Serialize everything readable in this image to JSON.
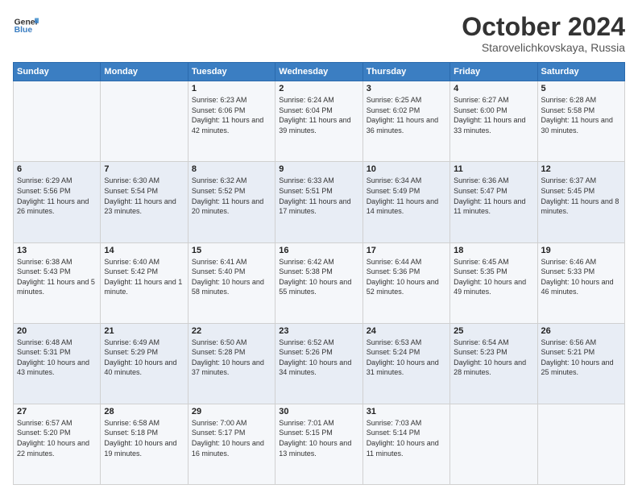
{
  "header": {
    "logo_line1": "General",
    "logo_line2": "Blue",
    "month": "October 2024",
    "location": "Starovelichkovskaya, Russia"
  },
  "weekdays": [
    "Sunday",
    "Monday",
    "Tuesday",
    "Wednesday",
    "Thursday",
    "Friday",
    "Saturday"
  ],
  "weeks": [
    [
      {
        "day": "",
        "text": ""
      },
      {
        "day": "",
        "text": ""
      },
      {
        "day": "1",
        "text": "Sunrise: 6:23 AM\nSunset: 6:06 PM\nDaylight: 11 hours and 42 minutes."
      },
      {
        "day": "2",
        "text": "Sunrise: 6:24 AM\nSunset: 6:04 PM\nDaylight: 11 hours and 39 minutes."
      },
      {
        "day": "3",
        "text": "Sunrise: 6:25 AM\nSunset: 6:02 PM\nDaylight: 11 hours and 36 minutes."
      },
      {
        "day": "4",
        "text": "Sunrise: 6:27 AM\nSunset: 6:00 PM\nDaylight: 11 hours and 33 minutes."
      },
      {
        "day": "5",
        "text": "Sunrise: 6:28 AM\nSunset: 5:58 PM\nDaylight: 11 hours and 30 minutes."
      }
    ],
    [
      {
        "day": "6",
        "text": "Sunrise: 6:29 AM\nSunset: 5:56 PM\nDaylight: 11 hours and 26 minutes."
      },
      {
        "day": "7",
        "text": "Sunrise: 6:30 AM\nSunset: 5:54 PM\nDaylight: 11 hours and 23 minutes."
      },
      {
        "day": "8",
        "text": "Sunrise: 6:32 AM\nSunset: 5:52 PM\nDaylight: 11 hours and 20 minutes."
      },
      {
        "day": "9",
        "text": "Sunrise: 6:33 AM\nSunset: 5:51 PM\nDaylight: 11 hours and 17 minutes."
      },
      {
        "day": "10",
        "text": "Sunrise: 6:34 AM\nSunset: 5:49 PM\nDaylight: 11 hours and 14 minutes."
      },
      {
        "day": "11",
        "text": "Sunrise: 6:36 AM\nSunset: 5:47 PM\nDaylight: 11 hours and 11 minutes."
      },
      {
        "day": "12",
        "text": "Sunrise: 6:37 AM\nSunset: 5:45 PM\nDaylight: 11 hours and 8 minutes."
      }
    ],
    [
      {
        "day": "13",
        "text": "Sunrise: 6:38 AM\nSunset: 5:43 PM\nDaylight: 11 hours and 5 minutes."
      },
      {
        "day": "14",
        "text": "Sunrise: 6:40 AM\nSunset: 5:42 PM\nDaylight: 11 hours and 1 minute."
      },
      {
        "day": "15",
        "text": "Sunrise: 6:41 AM\nSunset: 5:40 PM\nDaylight: 10 hours and 58 minutes."
      },
      {
        "day": "16",
        "text": "Sunrise: 6:42 AM\nSunset: 5:38 PM\nDaylight: 10 hours and 55 minutes."
      },
      {
        "day": "17",
        "text": "Sunrise: 6:44 AM\nSunset: 5:36 PM\nDaylight: 10 hours and 52 minutes."
      },
      {
        "day": "18",
        "text": "Sunrise: 6:45 AM\nSunset: 5:35 PM\nDaylight: 10 hours and 49 minutes."
      },
      {
        "day": "19",
        "text": "Sunrise: 6:46 AM\nSunset: 5:33 PM\nDaylight: 10 hours and 46 minutes."
      }
    ],
    [
      {
        "day": "20",
        "text": "Sunrise: 6:48 AM\nSunset: 5:31 PM\nDaylight: 10 hours and 43 minutes."
      },
      {
        "day": "21",
        "text": "Sunrise: 6:49 AM\nSunset: 5:29 PM\nDaylight: 10 hours and 40 minutes."
      },
      {
        "day": "22",
        "text": "Sunrise: 6:50 AM\nSunset: 5:28 PM\nDaylight: 10 hours and 37 minutes."
      },
      {
        "day": "23",
        "text": "Sunrise: 6:52 AM\nSunset: 5:26 PM\nDaylight: 10 hours and 34 minutes."
      },
      {
        "day": "24",
        "text": "Sunrise: 6:53 AM\nSunset: 5:24 PM\nDaylight: 10 hours and 31 minutes."
      },
      {
        "day": "25",
        "text": "Sunrise: 6:54 AM\nSunset: 5:23 PM\nDaylight: 10 hours and 28 minutes."
      },
      {
        "day": "26",
        "text": "Sunrise: 6:56 AM\nSunset: 5:21 PM\nDaylight: 10 hours and 25 minutes."
      }
    ],
    [
      {
        "day": "27",
        "text": "Sunrise: 6:57 AM\nSunset: 5:20 PM\nDaylight: 10 hours and 22 minutes."
      },
      {
        "day": "28",
        "text": "Sunrise: 6:58 AM\nSunset: 5:18 PM\nDaylight: 10 hours and 19 minutes."
      },
      {
        "day": "29",
        "text": "Sunrise: 7:00 AM\nSunset: 5:17 PM\nDaylight: 10 hours and 16 minutes."
      },
      {
        "day": "30",
        "text": "Sunrise: 7:01 AM\nSunset: 5:15 PM\nDaylight: 10 hours and 13 minutes."
      },
      {
        "day": "31",
        "text": "Sunrise: 7:03 AM\nSunset: 5:14 PM\nDaylight: 10 hours and 11 minutes."
      },
      {
        "day": "",
        "text": ""
      },
      {
        "day": "",
        "text": ""
      }
    ]
  ]
}
